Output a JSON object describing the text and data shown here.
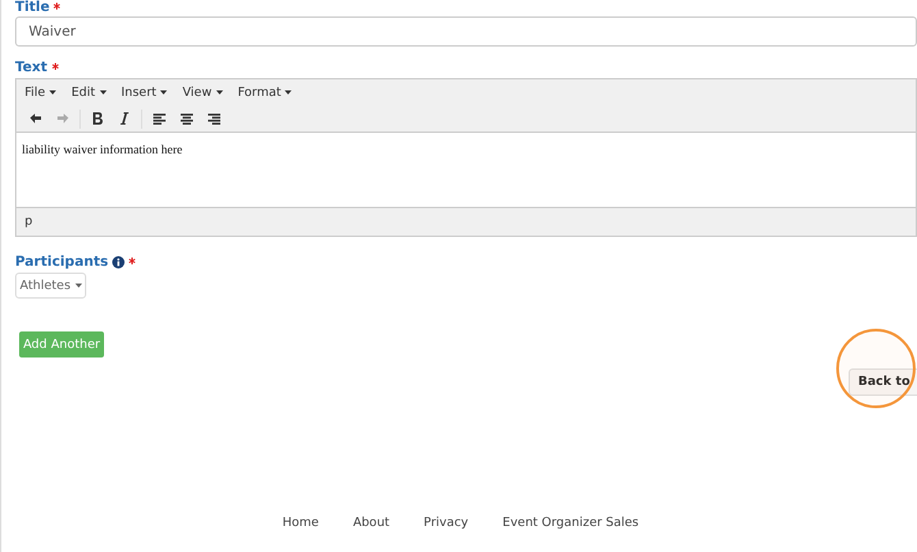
{
  "title_field": {
    "label": "Title",
    "required": true,
    "value": "Waiver"
  },
  "text_field": {
    "label": "Text",
    "required": true,
    "menu": [
      "File",
      "Edit",
      "Insert",
      "View",
      "Format"
    ],
    "toolbar": [
      {
        "kind": "undo",
        "disabled": false
      },
      {
        "kind": "redo",
        "disabled": true
      },
      {
        "kind": "bold",
        "disabled": false
      },
      {
        "kind": "italic",
        "disabled": false
      },
      {
        "kind": "align-left",
        "disabled": false
      },
      {
        "kind": "align-center",
        "disabled": false
      },
      {
        "kind": "align-right",
        "disabled": false
      }
    ],
    "content": "liability waiver information here",
    "status_path": "p"
  },
  "participants": {
    "label": "Participants",
    "required": true,
    "value": "Athletes"
  },
  "add_button": "Add Another",
  "back_button": "Back to",
  "footer_links": [
    "Home",
    "About",
    "Privacy",
    "Event Organizer Sales"
  ]
}
